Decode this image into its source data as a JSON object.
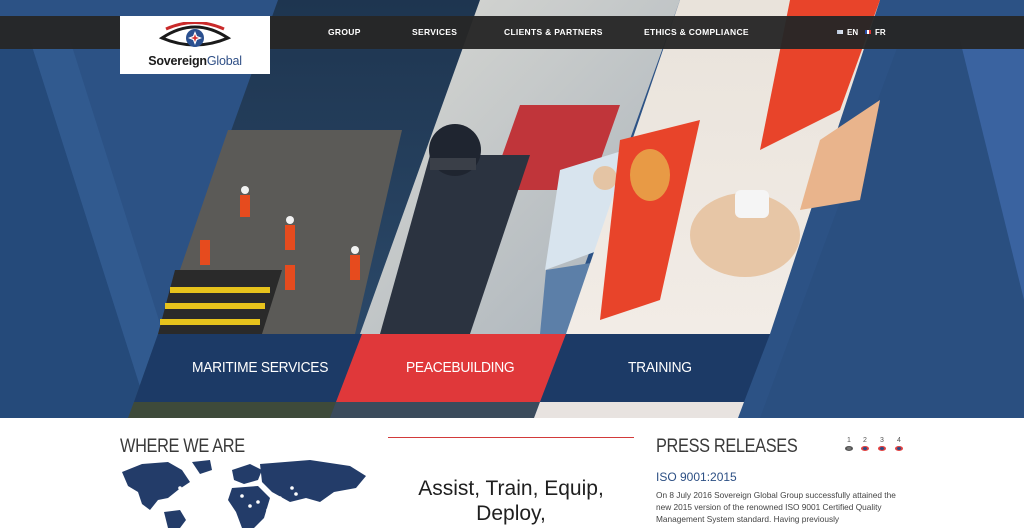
{
  "brand": {
    "name_bold": "Sovereign",
    "name_light": "Global",
    "colors": {
      "navy": "#2c5285",
      "red": "#e0383a",
      "dark_blue": "#1c355f",
      "topbar": "#262626"
    }
  },
  "nav": {
    "items": [
      {
        "label": "GROUP"
      },
      {
        "label": "SERVICES"
      },
      {
        "label": "CLIENTS & PARTNERS"
      },
      {
        "label": "ETHICS & COMPLIANCE"
      }
    ],
    "languages": [
      {
        "label": "EN",
        "flag": "gb-flag-icon"
      },
      {
        "label": "FR",
        "flag": "fr-flag-icon"
      }
    ]
  },
  "hero": {
    "panels": [
      {
        "label": "MARITIME SERVICES",
        "photo": "offshore-crew-photo"
      },
      {
        "label": "PEACEBUILDING",
        "photo": "helicopter-rescue-photo"
      },
      {
        "label": "TRAINING",
        "photo": "first-aid-training-photo"
      }
    ]
  },
  "where_we_are": {
    "title": "WHERE WE ARE",
    "icon": "world-map-icon"
  },
  "mission": {
    "tagline_line1": "Assist, Train, Equip,",
    "tagline_line2": "Deploy,"
  },
  "press": {
    "title": "PRESS RELEASES",
    "pages": [
      "1",
      "2",
      "3",
      "4"
    ],
    "active_page": "1",
    "headline": "ISO 9001:2015",
    "body": "On 8 July 2016 Sovereign Global Group successfully attained the new 2015 version of the renowned ISO 9001 Certified Quality Management System standard. Having previously"
  }
}
